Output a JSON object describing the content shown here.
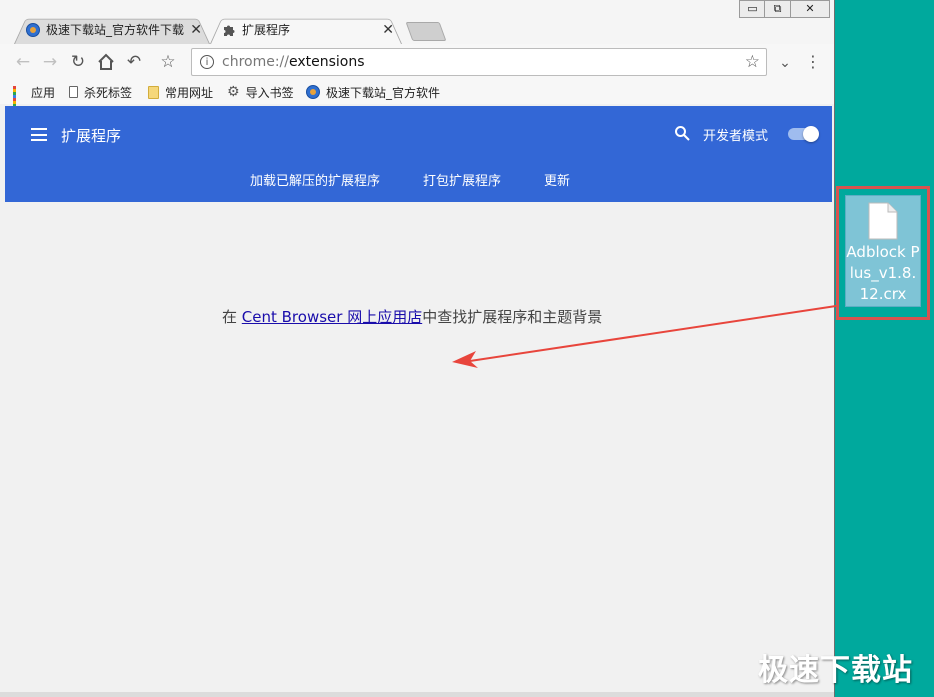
{
  "window_controls": {
    "minimize": "▭",
    "restore": "⧉",
    "close": "✕"
  },
  "tabs": [
    {
      "title": "极速下载站_官方软件下载",
      "favicon": "site-globe-icon"
    },
    {
      "title": "扩展程序",
      "favicon": "puzzle-icon"
    }
  ],
  "omnibox": {
    "scheme": "chrome://",
    "path": "extensions"
  },
  "bookmarks": [
    {
      "label": "应用",
      "icon": "apps-grid-icon"
    },
    {
      "label": "杀死标签",
      "icon": "page-icon"
    },
    {
      "label": "常用网址",
      "icon": "folder-icon"
    },
    {
      "label": "导入书签",
      "icon": "gear-icon"
    },
    {
      "label": "极速下载站_官方软件",
      "icon": "site-globe-icon"
    }
  ],
  "extensions_page": {
    "title": "扩展程序",
    "developer_mode_label": "开发者模式",
    "developer_mode_on": true,
    "actions": [
      "加载已解压的扩展程序",
      "打包扩展程序",
      "更新"
    ],
    "empty_message": {
      "prefix": "在 ",
      "link": "Cent Browser 网上应用店",
      "suffix": "中查找扩展程序和主题背景"
    }
  },
  "desktop_file": {
    "name": "Adblock Plus_v1.8.12.crx"
  },
  "watermark": "极速下载站",
  "colors": {
    "header_blue": "#3367d6",
    "desktop_teal": "#00a99d",
    "annotation_red": "#d9534f"
  }
}
